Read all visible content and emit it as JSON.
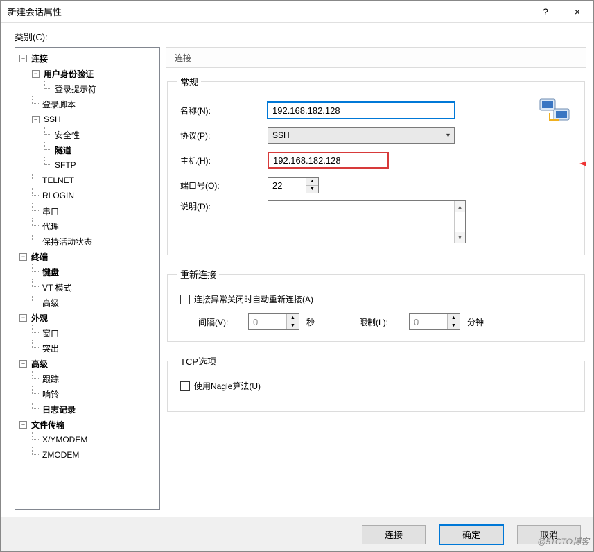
{
  "window": {
    "title": "新建会话属性",
    "help": "?",
    "close": "×"
  },
  "categoryLabel": "类别(C):",
  "tree": {
    "items": [
      {
        "label": "连接",
        "bold": true,
        "toggle": "−",
        "level": 0,
        "children": [
          {
            "label": "用户身份验证",
            "bold": true,
            "toggle": "−",
            "level": 1,
            "children": [
              {
                "label": "登录提示符",
                "level": 2
              }
            ]
          },
          {
            "label": "登录脚本",
            "level": 1
          },
          {
            "label": "SSH",
            "toggle": "−",
            "level": 1,
            "children": [
              {
                "label": "安全性",
                "level": 2
              },
              {
                "label": "隧道",
                "bold": true,
                "level": 2
              },
              {
                "label": "SFTP",
                "level": 2
              }
            ]
          },
          {
            "label": "TELNET",
            "level": 1
          },
          {
            "label": "RLOGIN",
            "level": 1
          },
          {
            "label": "串口",
            "level": 1
          },
          {
            "label": "代理",
            "level": 1
          },
          {
            "label": "保持活动状态",
            "level": 1
          }
        ]
      },
      {
        "label": "终端",
        "bold": true,
        "toggle": "−",
        "level": 0,
        "children": [
          {
            "label": "键盘",
            "bold": true,
            "level": 1
          },
          {
            "label": "VT 模式",
            "level": 1
          },
          {
            "label": "高级",
            "level": 1
          }
        ]
      },
      {
        "label": "外观",
        "bold": true,
        "toggle": "−",
        "level": 0,
        "children": [
          {
            "label": "窗口",
            "level": 1
          },
          {
            "label": "突出",
            "level": 1
          }
        ]
      },
      {
        "label": "高级",
        "bold": true,
        "toggle": "−",
        "level": 0,
        "children": [
          {
            "label": "跟踪",
            "level": 1
          },
          {
            "label": "响铃",
            "level": 1
          },
          {
            "label": "日志记录",
            "bold": true,
            "level": 1
          }
        ]
      },
      {
        "label": "文件传输",
        "bold": true,
        "toggle": "−",
        "level": 0,
        "children": [
          {
            "label": "X/YMODEM",
            "level": 1
          },
          {
            "label": "ZMODEM",
            "level": 1
          }
        ]
      }
    ]
  },
  "panel": {
    "header": "连接",
    "general": {
      "legend": "常规",
      "nameLabel": "名称(N):",
      "nameValue": "192.168.182.128",
      "protocolLabel": "协议(P):",
      "protocolValue": "SSH",
      "hostLabel": "主机(H):",
      "hostValue": "192.168.182.128",
      "portLabel": "端口号(O):",
      "portValue": "22",
      "descLabel": "说明(D):",
      "descValue": ""
    },
    "reconnect": {
      "legend": "重新连接",
      "autoLabel": "连接异常关闭时自动重新连接(A)",
      "intervalLabel": "间隔(V):",
      "intervalValue": "0",
      "secUnit": "秒",
      "limitLabel": "限制(L):",
      "limitValue": "0",
      "minUnit": "分钟"
    },
    "tcp": {
      "legend": "TCP选项",
      "nagleLabel": "使用Nagle算法(U)"
    }
  },
  "buttons": {
    "connect": "连接",
    "ok": "确定",
    "cancel": "取消"
  },
  "watermark": "@51CTO博客"
}
